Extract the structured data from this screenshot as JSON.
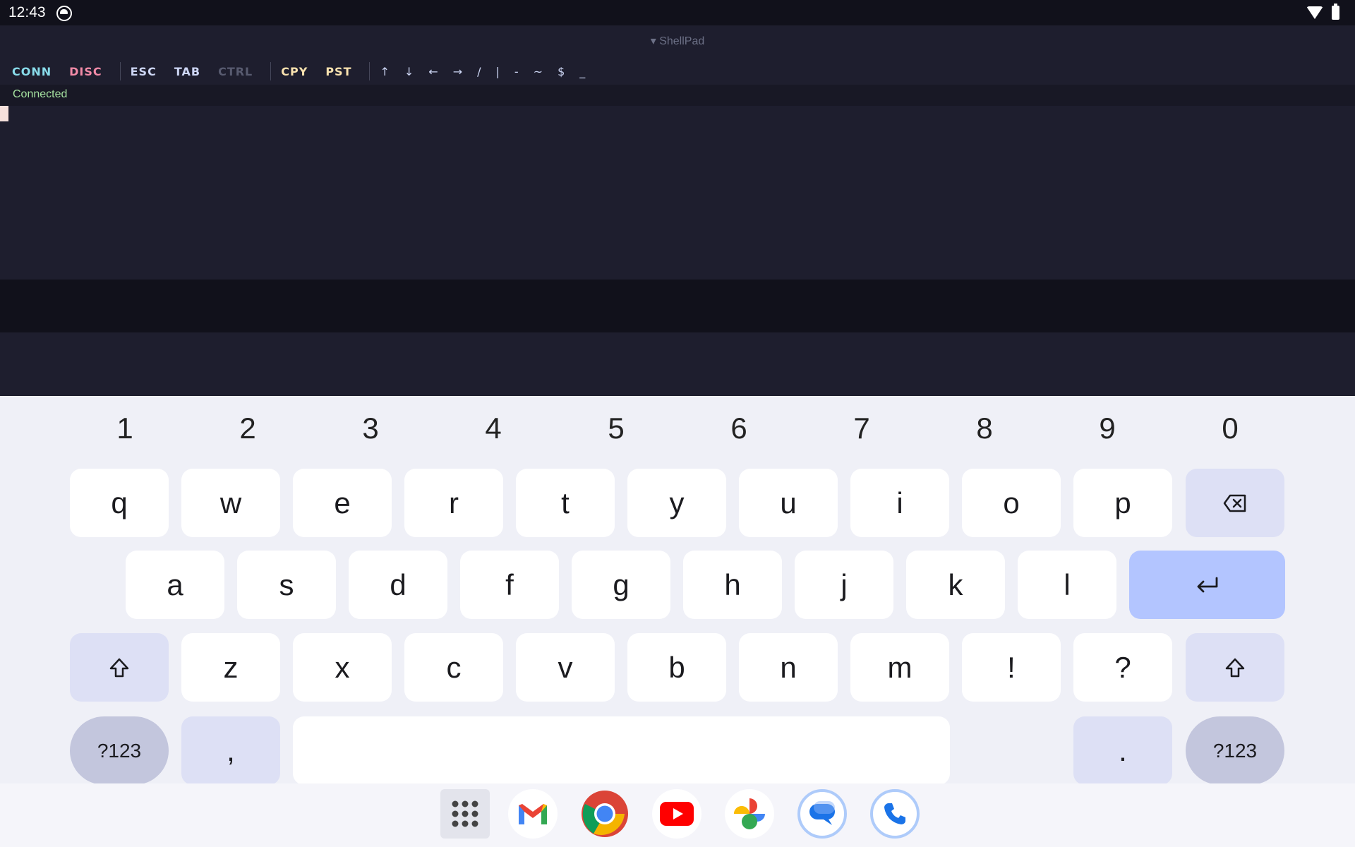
{
  "status_bar": {
    "time": "12:43"
  },
  "app": {
    "title": "▾ ShellPad"
  },
  "toolbar": {
    "conn": "CONN",
    "disc": "DISC",
    "esc": "ESC",
    "tab": "TAB",
    "ctrl": "CTRL",
    "cpy": "CPY",
    "pst": "PST",
    "symbols": [
      "↑",
      "↓",
      "←",
      "→",
      "/",
      "|",
      "-",
      "~",
      "$",
      "_"
    ]
  },
  "connection": {
    "status": "Connected"
  },
  "keyboard": {
    "numbers": [
      "1",
      "2",
      "3",
      "4",
      "5",
      "6",
      "7",
      "8",
      "9",
      "0"
    ],
    "row1": [
      "q",
      "w",
      "e",
      "r",
      "t",
      "y",
      "u",
      "i",
      "o",
      "p"
    ],
    "row2": [
      "a",
      "s",
      "d",
      "f",
      "g",
      "h",
      "j",
      "k",
      "l"
    ],
    "row3": [
      "z",
      "x",
      "c",
      "v",
      "b",
      "n",
      "m",
      "!",
      "?"
    ],
    "sym_label": "?123",
    "comma": ",",
    "period": "."
  },
  "dock": {
    "apps": [
      "app-drawer",
      "Gmail",
      "Chrome",
      "YouTube",
      "Photos",
      "Messages",
      "Phone"
    ]
  }
}
